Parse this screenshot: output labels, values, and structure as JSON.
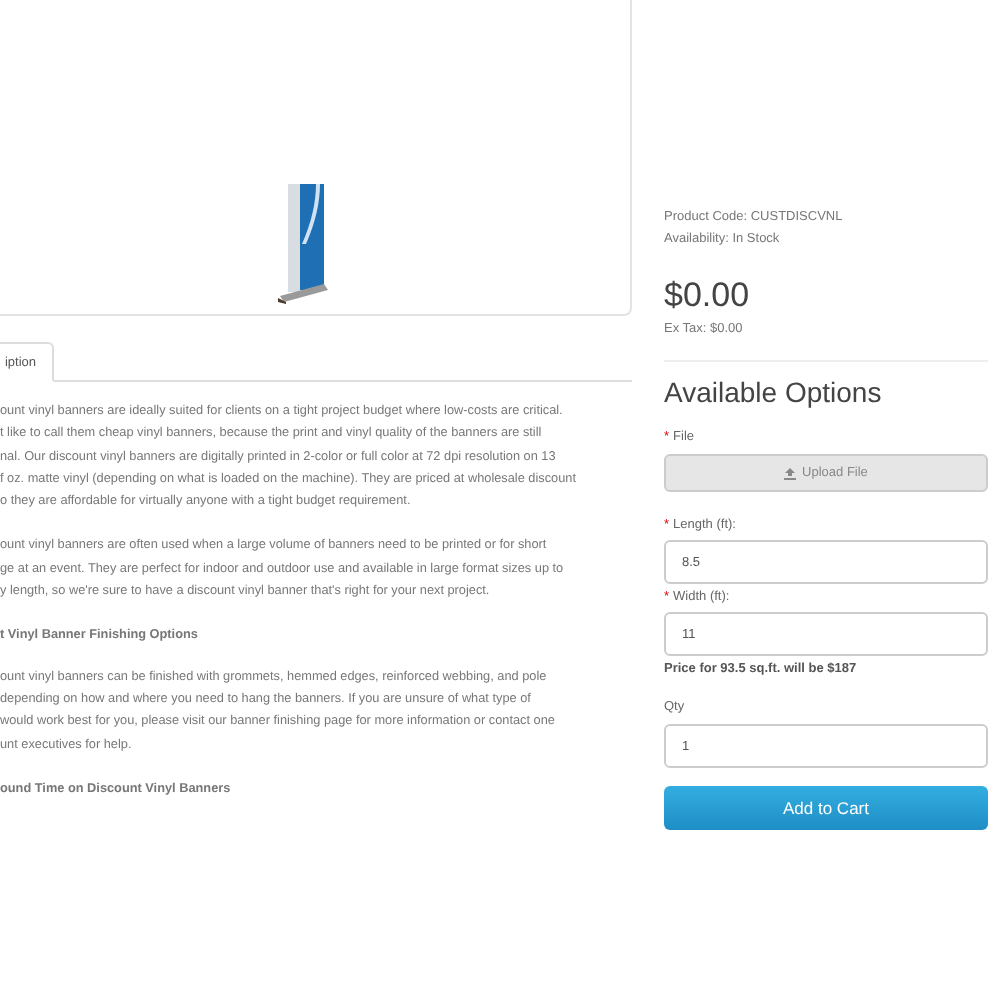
{
  "tabs": [
    {
      "label": "iption",
      "selected": true
    }
  ],
  "description": [
    {
      "kind": "para",
      "lines": [
        "ount vinyl banners are ideally suited for clients on a tight project budget where low-costs are critical.",
        "t like to call them cheap vinyl banners, because the print and vinyl quality of the banners are still",
        "nal. Our discount vinyl banners are digitally printed in 2-color or full color at 72 dpi resolution on 13",
        "f oz. matte vinyl (depending on what is loaded on the machine). They are priced at wholesale discount",
        "o they are affordable for virtually anyone with a tight budget requirement."
      ]
    },
    {
      "kind": "para",
      "lines": [
        "ount vinyl banners are often used when a large volume of banners need to be printed or for short",
        "ge at an event. They are perfect for indoor and outdoor use and available in large format sizes up to",
        "y length, so we're sure to have a discount vinyl banner that's right for your next project."
      ]
    },
    {
      "kind": "heading",
      "lines": [
        "t Vinyl Banner Finishing Options"
      ]
    },
    {
      "kind": "para",
      "lines": [
        "ount vinyl banners can be finished with grommets, hemmed edges, reinforced webbing, and pole",
        " depending on how and where you need to hang the banners. If you are unsure of what type of",
        " would work best for you, please visit our banner finishing page for more information or contact one",
        "unt executives for help."
      ]
    },
    {
      "kind": "heading",
      "lines": [
        "ound Time on Discount Vinyl Banners"
      ]
    }
  ],
  "product_code": "Product Code: CUSTDISCVNL",
  "availability": "Availability: In Stock",
  "price": "$0.00",
  "ex_tax": "Ex Tax: $0.00",
  "options_title": "Available Options",
  "options": [
    {
      "kind": "file",
      "required_mark": "*",
      "label": "File",
      "button": "Upload File"
    },
    {
      "kind": "text",
      "required_mark": "*",
      "label": "Length (ft):",
      "value": "8.5"
    },
    {
      "kind": "text",
      "required_mark": "*",
      "label": "Width (ft):",
      "value": "11"
    }
  ],
  "price_note": "Price for 93.5 sq.ft. will be $187",
  "qty": {
    "label": "Qty",
    "value": "1"
  },
  "add_to_cart": "Add to Cart"
}
